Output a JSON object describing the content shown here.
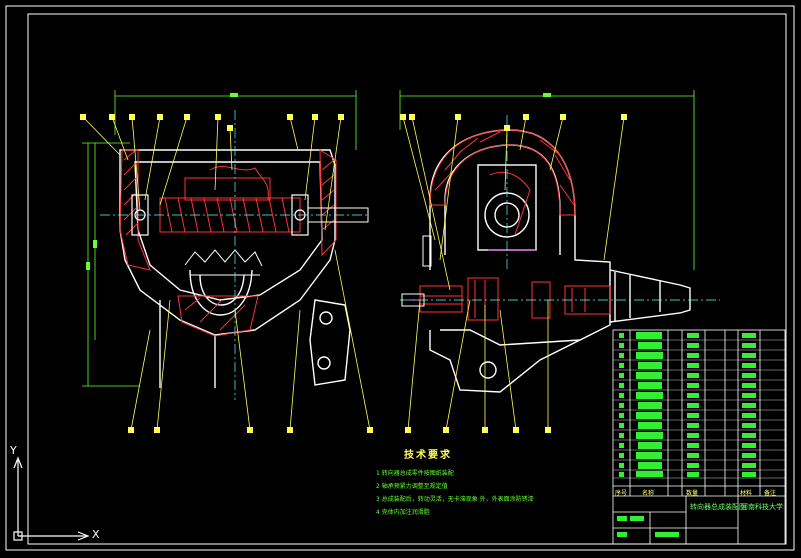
{
  "drawing": {
    "tech_requirements": {
      "title": "技术要求",
      "items": [
        "1 转向器总成零件按图纸装配",
        "2 轴承预紧力调整至规定值",
        "3 总成装配后，转动灵活，无卡滞现象   外，外表面涂防锈漆",
        "4 壳体内加注润滑脂"
      ]
    },
    "title_block": {
      "drawing_name": "转向器总成装配图",
      "institution": "河南科技大学",
      "header_labels": [
        "序号",
        "名称",
        "数量",
        "材料",
        "备注"
      ]
    },
    "ucs": {
      "x_label": "X",
      "y_label": "Y"
    },
    "colors": {
      "background": "#000000",
      "outline": "#ffffff",
      "section": "#ff3333",
      "dimension": "#66ff33",
      "leader": "#ffff55",
      "center": "#55ffff",
      "hatch": "#ff66ff"
    }
  }
}
